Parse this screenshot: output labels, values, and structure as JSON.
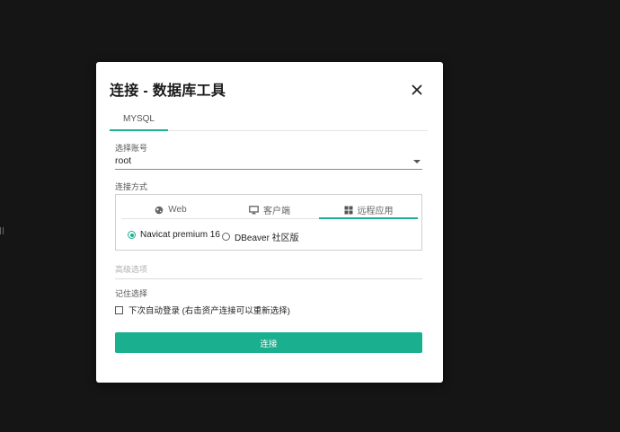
{
  "dialog": {
    "title": "连接 - 数据库工具",
    "close_icon": "close-icon"
  },
  "top_tabs": [
    {
      "label": "MYSQL",
      "active": true
    }
  ],
  "account": {
    "label": "选择账号",
    "value": "root"
  },
  "method": {
    "label": "连接方式",
    "tabs": [
      {
        "label": "Web",
        "icon": "globe-icon",
        "active": false
      },
      {
        "label": "客户端",
        "icon": "monitor-icon",
        "active": false
      },
      {
        "label": "远程应用",
        "icon": "windows-icon",
        "active": true
      }
    ],
    "options": [
      {
        "label": "Navicat premium 16",
        "checked": true
      },
      {
        "label": "DBeaver 社区版",
        "checked": false
      }
    ]
  },
  "advanced": {
    "label": "高级选项"
  },
  "remember": {
    "label": "记住选择",
    "checkbox_label": "下次自动登录 (右击资产连接可以重新选择)",
    "checked": false
  },
  "connect_button": {
    "label": "连接"
  },
  "colors": {
    "accent": "#1aaf8f",
    "backdrop": "#151515",
    "dialog_bg": "#ffffff"
  }
}
